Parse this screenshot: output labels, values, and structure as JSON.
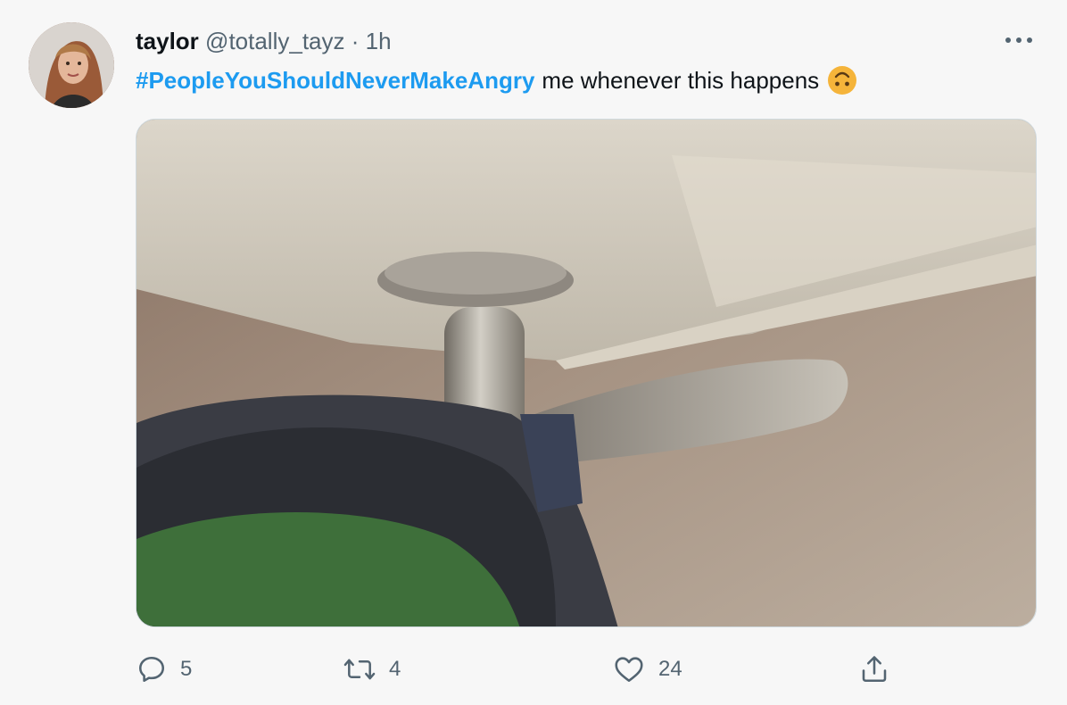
{
  "tweet": {
    "display_name": "taylor",
    "handle": "@totally_tayz",
    "separator": "·",
    "time": "1h",
    "hashtag": "#PeopleYouShouldNeverMakeAngry",
    "text": "me whenever this happens",
    "emoji": "upside-down-face-emoji"
  },
  "actions": {
    "replies": "5",
    "retweets": "4",
    "likes": "24"
  },
  "icons": {
    "more": "more-horizontal-icon",
    "reply": "reply-icon",
    "retweet": "retweet-icon",
    "like": "heart-icon",
    "share": "share-icon"
  },
  "colors": {
    "link": "#1d9bf0",
    "secondary_text": "#536471",
    "primary_text": "#0f1419"
  }
}
